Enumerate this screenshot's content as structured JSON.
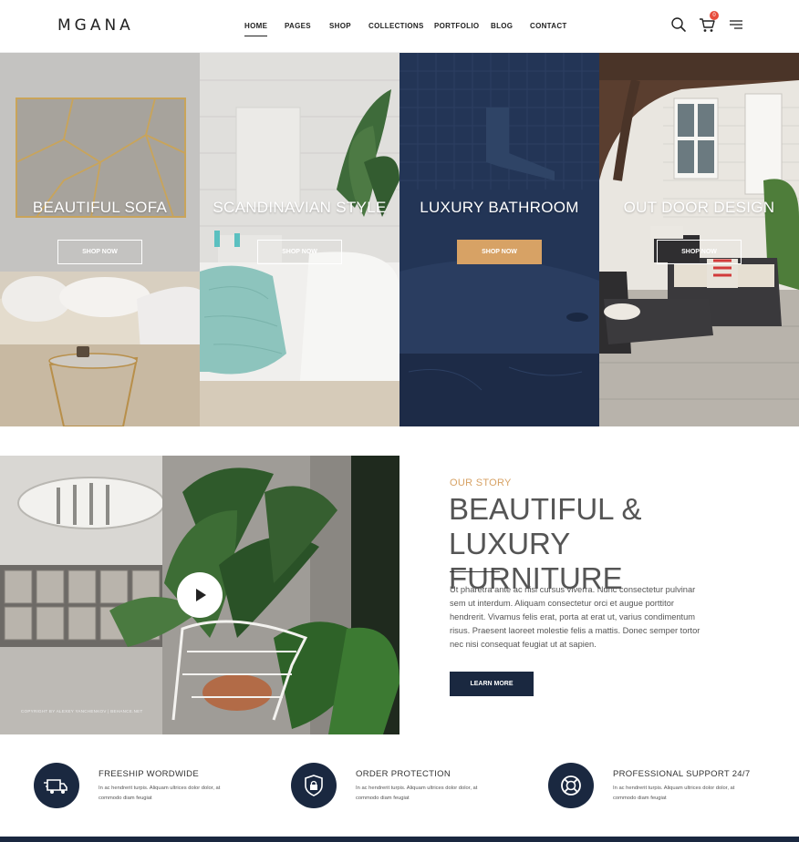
{
  "header": {
    "logo": "MGANA",
    "nav": [
      "HOME",
      "PAGES",
      "SHOP",
      "COLLECTIONS",
      "PORTFOLIO",
      "BLOG",
      "CONTACT"
    ],
    "active_nav": "HOME",
    "icons": [
      "search-icon",
      "cart-icon",
      "menu-icon"
    ],
    "cart_count": "0"
  },
  "hero": {
    "panels": [
      {
        "title": "BEAUTIFUL SOFA",
        "button": "SHOP NOW"
      },
      {
        "title": "SCANDINAVIAN STYLE",
        "button": "SHOP NOW"
      },
      {
        "title": "LUXURY BATHROOM",
        "button": "SHOP NOW"
      },
      {
        "title": "OUT DOOR DESIGN",
        "button": "SHOP NOW"
      }
    ]
  },
  "story": {
    "eyebrow": "OUR STORY",
    "title": "BEAUTIFUL & LUXURY FURNITURE",
    "body": "Ut pharetra ante ac nisl cursus viverra. Nunc consectetur pulvinar sem ut interdum. Aliquam consectetur orci et augue porttitor hendrerit. Vivamus felis erat, porta at erat ut, varius condimentum risus. Praesent laoreet molestie felis a mattis. Donec semper tortor nec nisi consequat feugiat ut at sapien.",
    "button": "LEARN MORE",
    "image_credit": "COPYRIGHT BY ALEXEY YANCHENKOV | BEHANCE.NET"
  },
  "features": [
    {
      "icon": "truck-icon",
      "title": "FREESHIP WORDWIDE",
      "text": "In ac hendrerit turpis. Aliquam ultrices dolor dolor, at commodo diam feugiat"
    },
    {
      "icon": "shield-lock-icon",
      "title": "ORDER PROTECTION",
      "text": "In ac hendrerit turpis. Aliquam ultrices dolor dolor, at commodo diam feugiat"
    },
    {
      "icon": "lifebuoy-icon",
      "title": "PROFESSIONAL SUPPORT 24/7",
      "text": "In ac hendrerit turpis. Aliquam ultrices dolor dolor, at commodo diam feugiat"
    }
  ],
  "colors": {
    "accent": "#d7a265",
    "navy": "#1a2840",
    "text": "#555555"
  }
}
